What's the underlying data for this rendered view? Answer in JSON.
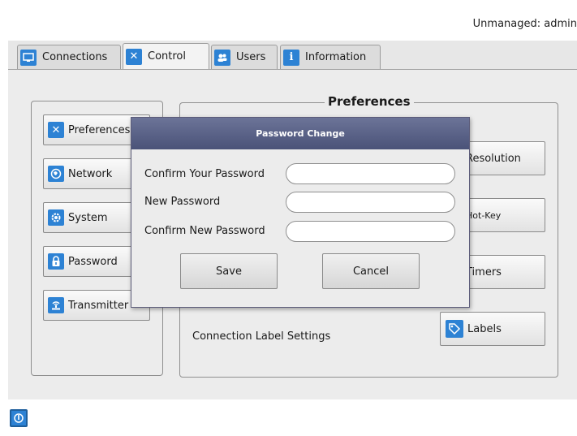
{
  "status": "Unmanaged: admin",
  "tabs": [
    {
      "label": "Connections",
      "icon": "monitor-icon"
    },
    {
      "label": "Control",
      "icon": "tools-icon"
    },
    {
      "label": "Users",
      "icon": "users-icon"
    },
    {
      "label": "Information",
      "icon": "info-icon"
    }
  ],
  "sidebar": {
    "items": [
      {
        "label": "Preferences",
        "icon": "tools-icon"
      },
      {
        "label": "Network",
        "icon": "globe-icon"
      },
      {
        "label": "System",
        "icon": "gear-icon"
      },
      {
        "label": "Password",
        "icon": "lock-icon"
      },
      {
        "label": "Transmitter",
        "icon": "transmitter-icon"
      }
    ]
  },
  "preferences": {
    "title": "Preferences",
    "buttons": [
      {
        "label": "Resolution"
      },
      {
        "label": "Hot-Key"
      },
      {
        "label": "Timers"
      },
      {
        "label": "Labels",
        "icon": "tag-icon"
      }
    ],
    "connection_label_text": "Connection Label Settings"
  },
  "dialog": {
    "title": "Password Change",
    "fields": [
      {
        "label": "Confirm Your Password",
        "value": ""
      },
      {
        "label": "New Password",
        "value": ""
      },
      {
        "label": "Confirm New Password",
        "value": ""
      }
    ],
    "save_label": "Save",
    "cancel_label": "Cancel"
  },
  "colors": {
    "accent": "#2d82d4",
    "dialog_title_bg": "#4f587e"
  }
}
